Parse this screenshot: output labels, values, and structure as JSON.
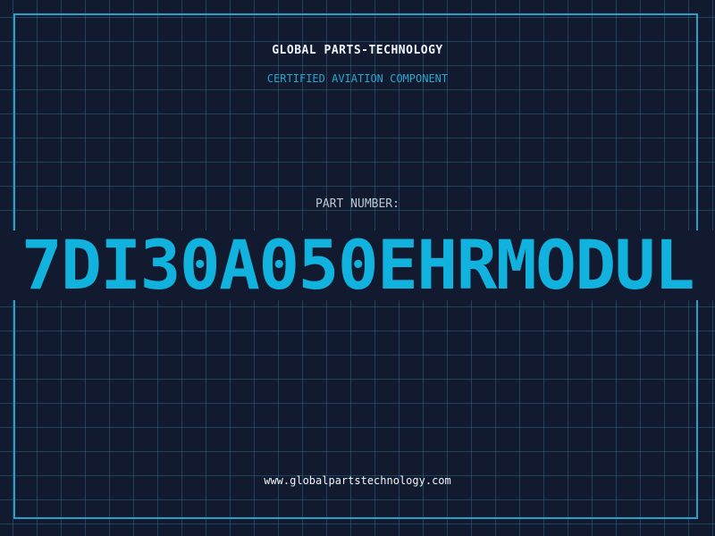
{
  "header": {
    "brand": "GLOBAL PARTS-TECHNOLOGY",
    "subtitle": "CERTIFIED AVIATION COMPONENT"
  },
  "part": {
    "label": "PART NUMBER:",
    "number": "7DI30A050EHRMODUL"
  },
  "footer": {
    "url": "www.globalpartstechnology.com"
  },
  "colors": {
    "background": "#111a2e",
    "grid": "#2c6480",
    "frame": "#2a9fc9",
    "accent": "#12b2de",
    "text": "#eef4fa"
  }
}
